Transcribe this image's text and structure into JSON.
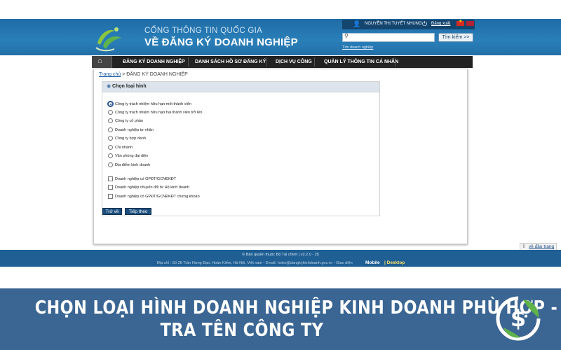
{
  "header": {
    "title_line1": "CỔNG THÔNG TIN QUỐC GIA",
    "title_line2": "VỀ ĐĂNG KÝ DOANH NGHIỆP",
    "user_name": "NGUYỄN THỊ TUYẾT NHUNG",
    "logout_label": "Đăng xuất",
    "search_placeholder": "",
    "search_button": "Tìm kiếm >>",
    "search_link": "Tìm doanh nghiệp"
  },
  "nav": {
    "items": [
      {
        "label": "ĐĂNG KÝ DOANH NGHIỆP"
      },
      {
        "label": "DANH SÁCH HỒ SƠ ĐĂNG KÝ"
      },
      {
        "label": "DỊCH VỤ CÔNG"
      },
      {
        "label": "QUẢN LÝ THÔNG TIN CÁ NHÂN"
      }
    ]
  },
  "breadcrumb": {
    "home": "Trang chủ",
    "current": " > ĐĂNG KÝ DOANH NGHIỆP"
  },
  "form": {
    "header": "Chọn loại hình",
    "radio_options": [
      {
        "label": "Công ty trách nhiệm hữu hạn một thành viên",
        "checked": true
      },
      {
        "label": "Công ty trách nhiệm hữu hạn hai thành viên trở lên",
        "checked": false
      },
      {
        "label": "Công ty cổ phần",
        "checked": false
      },
      {
        "label": "Doanh nghiệp tư nhân",
        "checked": false
      },
      {
        "label": "Công ty hợp danh",
        "checked": false
      },
      {
        "label": "Chi nhánh",
        "checked": false
      },
      {
        "label": "Văn phòng đại diện",
        "checked": false
      },
      {
        "label": "Địa điểm kinh doanh",
        "checked": false
      }
    ],
    "checkbox_options": [
      {
        "label": "Doanh nghiệp có GPĐT/GCNĐKĐT",
        "checked": false
      },
      {
        "label": "Doanh nghiệp chuyển đổi từ Hộ kinh doanh",
        "checked": false
      },
      {
        "label": "Doanh nghiệp có GPĐT/GCNĐKĐT chứng khoán",
        "checked": false
      }
    ],
    "back_button": "Trở về",
    "next_button": "Tiếp theo"
  },
  "footer": {
    "copyright": "© Bản quyền thuộc Bộ Tài chính | v2.2.0 - 25",
    "address": "Địa chỉ : Số 28 Trần Hưng Đạo, Hoàn Kiếm, Hà Nội, Việt nam - Email: hotro@dangkykinhdoanh.gov.vn - Giao diện",
    "mobile": "Mobile",
    "desktop": "| Desktop",
    "top_link": "về đầu trang"
  },
  "banner": {
    "line1": "CHỌN LOẠI HÌNH DOANH NGHIỆP KINH DOANH PHÙ HỢP -",
    "line2": "TRA TÊN CÔNG TY"
  },
  "colors": {
    "header_blue": "#2a7fb9",
    "nav_black": "#222222",
    "footer_blue": "#1f5f93",
    "banner_blue": "#3b6693",
    "button_navy": "#1c4e7d",
    "logo_green": "#5fb34a"
  }
}
